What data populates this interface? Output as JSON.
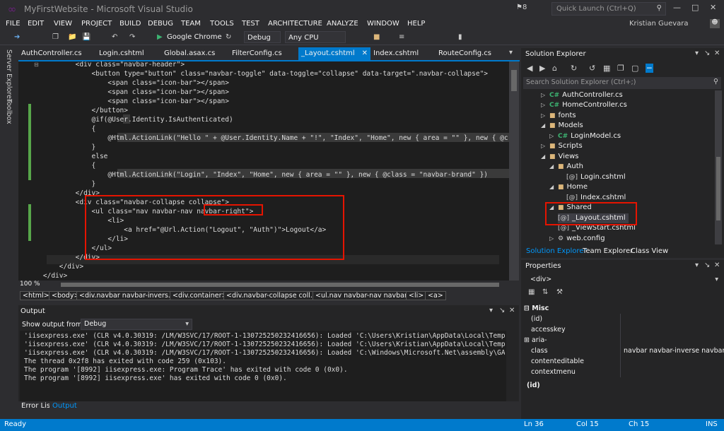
{
  "window": {
    "title": "MyFirstWebsite - Microsoft Visual Studio",
    "notif_count": "8",
    "quick_launch": "Quick Launch (Ctrl+Q)",
    "user": "Kristian Guevara"
  },
  "menu": [
    "FILE",
    "EDIT",
    "VIEW",
    "PROJECT",
    "BUILD",
    "DEBUG",
    "TEAM",
    "TOOLS",
    "TEST",
    "ARCHITECTURE",
    "ANALYZE",
    "WINDOW",
    "HELP"
  ],
  "toolbar": {
    "browser": "Google Chrome",
    "config": "Debug",
    "platform": "Any CPU"
  },
  "left_tools": [
    "Server Explorer",
    "Toolbox"
  ],
  "tabs": [
    "AuthController.cs",
    "Login.cshtml",
    "Global.asax.cs",
    "FilterConfig.cs",
    "_Layout.cshtml",
    "Index.cshtml",
    "RouteConfig.cs"
  ],
  "active_tab": "_Layout.cshtml",
  "code": [
    "            <div class=\"navbar-header\">",
    "                <button type=\"button\" class=\"navbar-toggle\" data-toggle=\"collapse\" data-target=\".navbar-collapse\">",
    "                    <span class=\"icon-bar\"></span>",
    "                    <span class=\"icon-bar\"></span>",
    "                    <span class=\"icon-bar\"></span>",
    "                </button>",
    "                @if(@User.Identity.IsAuthenticated)",
    "                {",
    "                    @Html.ActionLink(\"Hello \" + @User.Identity.Name + \"!\", \"Index\", \"Home\", new { area = \"\" }, new { @c",
    "                }",
    "                else",
    "                {",
    "                    @Html.ActionLink(\"Login\", \"Index\", \"Home\", new { area = \"\" }, new { @class = \"navbar-brand\" })",
    "                }",
    "            </div>",
    "            <div class=\"navbar-collapse collapse\">",
    "                <ul class=\"nav navbar-nav navbar-right\">",
    "                    <li>",
    "                        <a href=\"@Url.Action(\"Logout\", \"Auth\")\">Logout</a>",
    "                    </li>",
    "                </ul>",
    "            </div>",
    "        </div>",
    "    </div>"
  ],
  "zoom": "100 %",
  "breadcrumb": [
    "<html>",
    "<body>",
    "<div.navbar navbar-invers...>",
    "<div.container>",
    "<div.navbar-collapse coll...>",
    "<ul.nav navbar-nav navbar...>",
    "<li>",
    "<a>"
  ],
  "output": {
    "title": "Output",
    "show_label": "Show output from:",
    "source": "Debug",
    "lines": [
      "'iisexpress.exe' (CLR v4.0.30319: /LM/W3SVC/17/ROOT-1-130725250232416656): Loaded 'C:\\Users\\Kristian\\AppData\\Local\\Temp\\Te",
      "'iisexpress.exe' (CLR v4.0.30319: /LM/W3SVC/17/ROOT-1-130725250232416656): Loaded 'C:\\Users\\Kristian\\AppData\\Local\\Temp\\Te",
      "'iisexpress.exe' (CLR v4.0.30319: /LM/W3SVC/17/ROOT-1-130725250232416656): Loaded 'C:\\Windows\\Microsoft.Net\\assembly\\GAC_MS",
      "The thread 0x2f8 has exited with code 259 (0x103).",
      "The program '[8992] iisexpress.exe: Program Trace' has exited with code 0 (0x0).",
      "The program '[8992] iisexpress.exe' has exited with code 0 (0x0)."
    ]
  },
  "bottom_tabs": [
    "Error List",
    "Output"
  ],
  "status": {
    "ready": "Ready",
    "ln": "Ln 36",
    "col": "Col 15",
    "ch": "Ch 15",
    "ins": "INS"
  },
  "solution_explorer": {
    "title": "Solution Explorer",
    "search": "Search Solution Explorer (Ctrl+;)",
    "tree": [
      {
        "label": "AuthController.cs",
        "kind": "cs"
      },
      {
        "label": "HomeController.cs",
        "kind": "cs"
      },
      {
        "label": "fonts",
        "kind": "folder"
      },
      {
        "label": "Models",
        "kind": "folder"
      },
      {
        "label": "LoginModel.cs",
        "kind": "cs"
      },
      {
        "label": "Scripts",
        "kind": "folder"
      },
      {
        "label": "Views",
        "kind": "folder"
      },
      {
        "label": "Auth",
        "kind": "folder"
      },
      {
        "label": "Login.cshtml",
        "kind": "file"
      },
      {
        "label": "Home",
        "kind": "folder"
      },
      {
        "label": "Index.cshtml",
        "kind": "file"
      },
      {
        "label": "Shared",
        "kind": "folder"
      },
      {
        "label": "_Layout.cshtml",
        "kind": "file"
      },
      {
        "label": "_ViewStart.cshtml",
        "kind": "file"
      },
      {
        "label": "web.config",
        "kind": "file"
      }
    ],
    "tabs": [
      "Solution Explorer",
      "Team Explorer",
      "Class View"
    ]
  },
  "properties": {
    "title": "Properties",
    "element": "<div>",
    "category": "Misc",
    "rows": [
      "(id)",
      "accesskey",
      "aria-",
      "class",
      "contenteditable",
      "contextmenu"
    ],
    "class_value": "navbar navbar-inverse navbar-",
    "footer": "(id)"
  }
}
